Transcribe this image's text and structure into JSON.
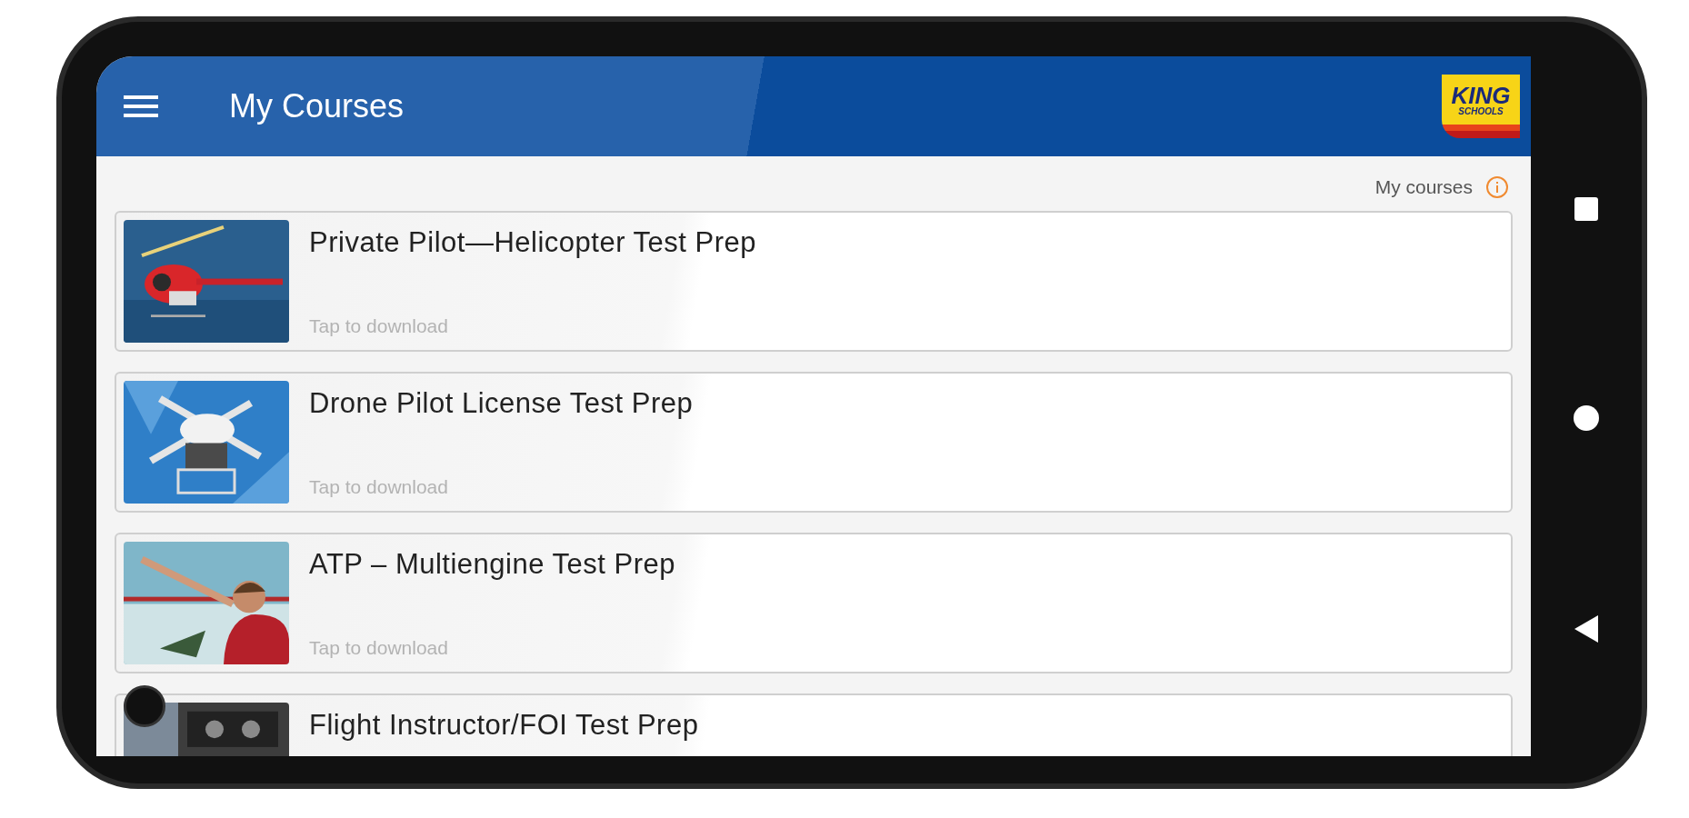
{
  "app_bar": {
    "title": "My Courses",
    "logo": {
      "line1": "KING",
      "line2": "SCHOOLS"
    }
  },
  "section_label": "My courses",
  "courses": [
    {
      "title": "Private Pilot—Helicopter Test Prep",
      "status": "Tap to download"
    },
    {
      "title": "Drone Pilot License Test Prep",
      "status": "Tap to download"
    },
    {
      "title": "ATP – Multiengine Test Prep",
      "status": "Tap to download"
    },
    {
      "title": "Flight Instructor/FOI Test Prep"
    }
  ]
}
